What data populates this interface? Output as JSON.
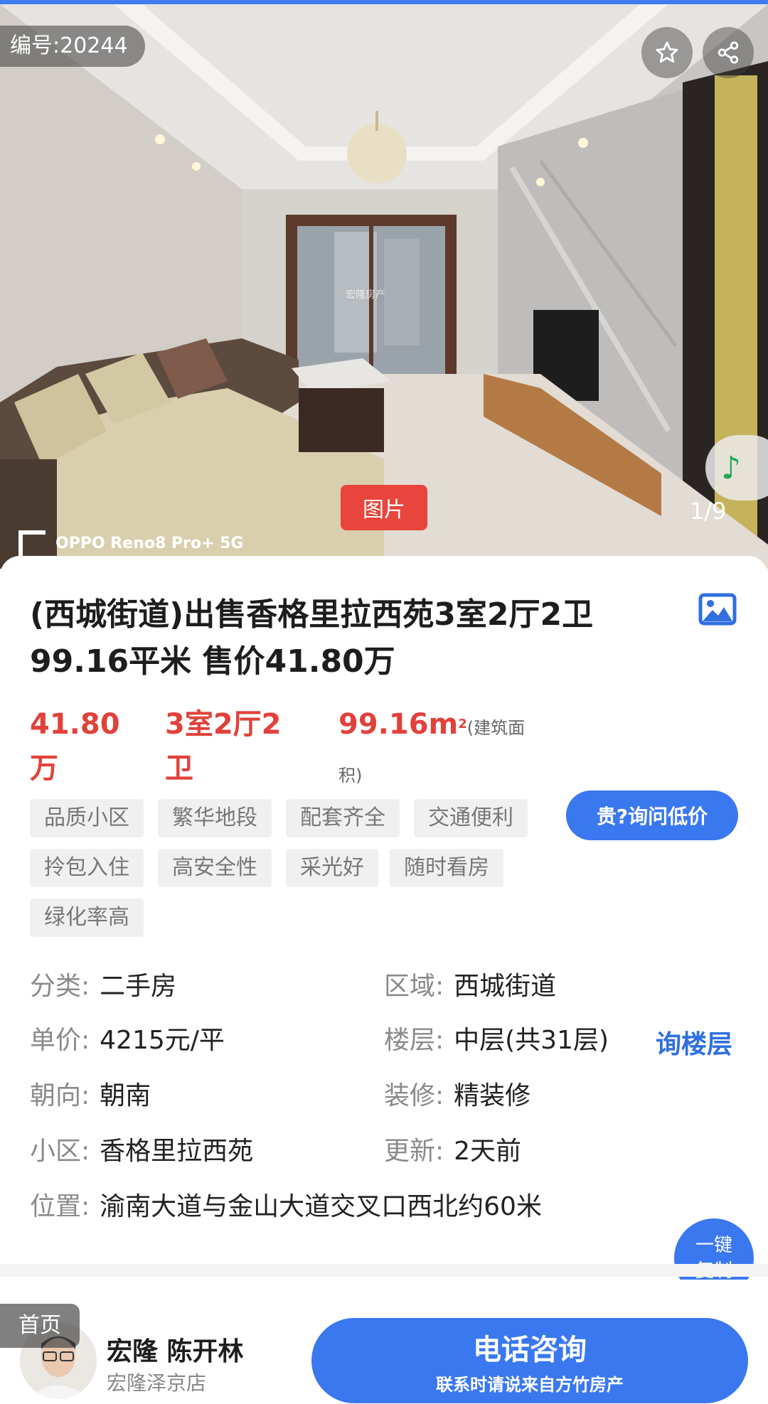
{
  "hero": {
    "listing_id": "编号:20244",
    "image_tag": "图片",
    "counter": "1/9",
    "watermark": "OPPO Reno8 Pro+ 5G",
    "photo_watermark": "宏隆房产"
  },
  "listing": {
    "title": "(西城街道)出售香格里拉西苑3室2厅2卫 99.16平米 售价41.80万",
    "price": "41.80万",
    "layout": "3室2厅2卫",
    "area": "99.16m",
    "area_sup": "2",
    "area_unit": "(建筑面积)",
    "ask_low_label": "贵?询问低价",
    "tags": [
      "品质小区",
      "繁华地段",
      "配套齐全",
      "交通便利",
      "拎包入住",
      "高安全性",
      "采光好",
      "随时看房",
      "绿化率高"
    ]
  },
  "attributes": {
    "category": {
      "label": "分类:",
      "value": "二手房"
    },
    "district": {
      "label": "区域:",
      "value": "西城街道"
    },
    "unit_price": {
      "label": "单价:",
      "value": "4215元/平"
    },
    "floor": {
      "label": "楼层:",
      "value": "中层(共31层)"
    },
    "orientation": {
      "label": "朝向:",
      "value": "朝南"
    },
    "decoration": {
      "label": "装修:",
      "value": "精装修"
    },
    "community": {
      "label": "小区:",
      "value": "香格里拉西苑"
    },
    "updated": {
      "label": "更新:",
      "value": "2天前"
    },
    "location": {
      "label": "位置:",
      "value": "渝南大道与金山大道交叉口西北约60米"
    },
    "ask_floor_label": "询楼层",
    "copy_line1": "一键",
    "copy_line2": "复制"
  },
  "footer": {
    "home_tab": "首页",
    "agent_name": "宏隆 陈开林",
    "agent_store": "宏隆泽京店",
    "call_label": "电话咨询",
    "call_sub": "联系时请说来自方竹房产"
  },
  "colors": {
    "accent_blue": "#3a78f0",
    "price_red": "#e2413b",
    "tag_bg": "#f0f0f0"
  },
  "icons": [
    "star-icon",
    "share-icon",
    "music-note-icon",
    "album-icon"
  ]
}
